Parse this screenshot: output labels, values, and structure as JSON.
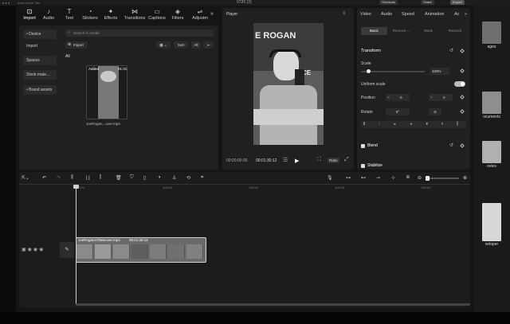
{
  "system": {
    "app_name": "Auto Movie Title",
    "clock": "0720 (3)",
    "shortcuts_label": "Shortcuts",
    "share_label": "Share",
    "export_label": "Export"
  },
  "toolbar": {
    "tabs": [
      {
        "label": "Import",
        "icon": "import-icon"
      },
      {
        "label": "Audio",
        "icon": "audio-icon"
      },
      {
        "label": "Text",
        "icon": "text-icon"
      },
      {
        "label": "Stickers",
        "icon": "stickers-icon"
      },
      {
        "label": "Effects",
        "icon": "effects-icon"
      },
      {
        "label": "Transitions",
        "icon": "transitions-icon"
      },
      {
        "label": "Captions",
        "icon": "captions-icon"
      },
      {
        "label": "Filters",
        "icon": "filters-icon"
      },
      {
        "label": "Adjustm",
        "icon": "adjustment-icon"
      }
    ],
    "more": "»"
  },
  "media": {
    "sidebar": [
      {
        "label": "• Device",
        "boxed": true
      },
      {
        "label": "Import",
        "boxed": false
      },
      {
        "label": "Spaces",
        "boxed": true
      },
      {
        "label": "Stock mate...",
        "boxed": true
      },
      {
        "label": "• Brand assets",
        "boxed": true
      }
    ],
    "search_placeholder": "Search in media",
    "import_label": "Import",
    "sort_label": "Sort",
    "all_label": "All",
    "filter_label": "All",
    "tab_all": "All",
    "item": {
      "badge": "Added",
      "duration": "01:31",
      "filename": "JoeRogan...over.mp4"
    }
  },
  "player": {
    "title": "Player",
    "timecode_current": "00:00:00:00",
    "timecode_total": "00:01:30:12",
    "ratio_label": "Ratio",
    "overlay_text_1": "E ROGAN",
    "overlay_text_2": "ENCE"
  },
  "props": {
    "tabs": [
      "Video",
      "Audio",
      "Speed",
      "Animation",
      "Ac"
    ],
    "more": "»",
    "segments": [
      "Basic",
      "Remove ...",
      "Mask",
      "Retouch"
    ],
    "transform_label": "Transform",
    "scale_label": "Scale",
    "scale_value": "100%",
    "scale_fraction": 0.12,
    "uniform_label": "Uniform scale",
    "position_label": "Position",
    "pos_x_label": "X",
    "pos_x": "0",
    "pos_y_label": "Y",
    "pos_y": "0",
    "rotate_label": "Rotate",
    "rotate_value": "0°",
    "blend_label": "Blend",
    "stabilize_label": "Stabilize"
  },
  "timeline": {
    "ruler": [
      "00:00",
      "100:00",
      "100:02",
      "100:03",
      "100:04"
    ],
    "clip_name": "JoeRoganAITakeover.mp4",
    "clip_duration": "00:01:30:12",
    "track_cover_label": "Cover"
  },
  "desktop": {
    "items": [
      "ages",
      "ocuments",
      "ovies",
      "veloper"
    ]
  }
}
